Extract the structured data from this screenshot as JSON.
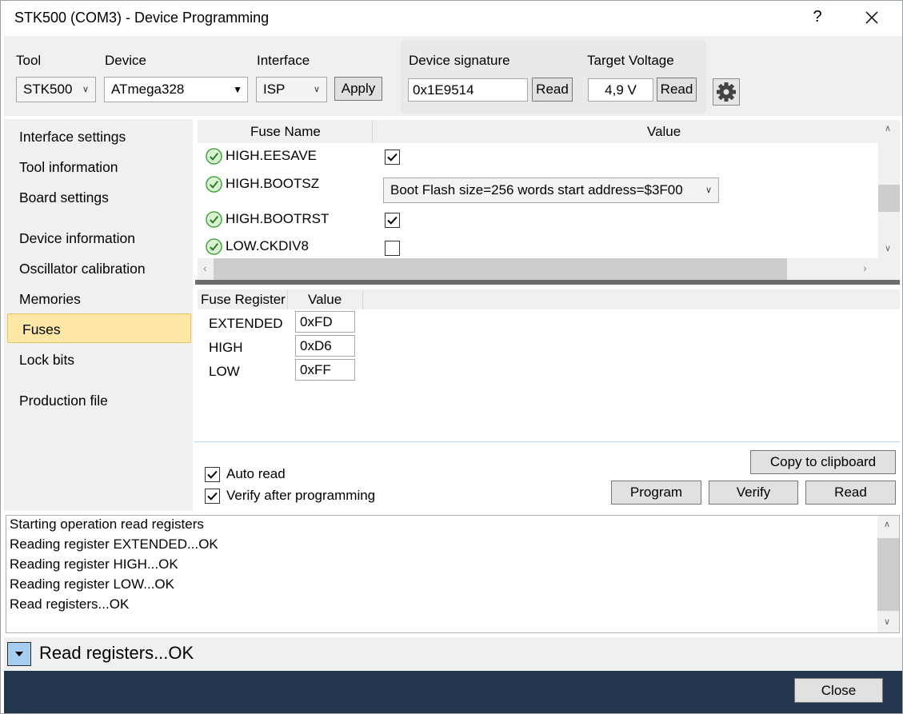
{
  "window": {
    "title": "STK500 (COM3) - Device Programming",
    "help": "?"
  },
  "toolbar": {
    "tool_label": "Tool",
    "tool_value": "STK500",
    "device_label": "Device",
    "device_value": "ATmega328",
    "interface_label": "Interface",
    "interface_value": "ISP",
    "apply": "Apply",
    "signature_label": "Device signature",
    "signature_value": "0x1E9514",
    "signature_read": "Read",
    "voltage_label": "Target Voltage",
    "voltage_value": "4,9 V",
    "voltage_read": "Read"
  },
  "nav": {
    "items": [
      {
        "label": "Interface settings"
      },
      {
        "label": "Tool information"
      },
      {
        "label": "Board settings"
      },
      {
        "label": "Device information"
      },
      {
        "label": "Oscillator calibration"
      },
      {
        "label": "Memories"
      },
      {
        "label": "Fuses"
      },
      {
        "label": "Lock bits"
      },
      {
        "label": "Production file"
      }
    ],
    "selected": "Fuses"
  },
  "fuses": {
    "col_name": "Fuse Name",
    "col_value": "Value",
    "rows": [
      {
        "name": "HIGH.EESAVE",
        "type": "checkbox",
        "checked": true
      },
      {
        "name": "HIGH.BOOTSZ",
        "type": "select",
        "value": "Boot Flash size=256 words start address=$3F00"
      },
      {
        "name": "HIGH.BOOTRST",
        "type": "checkbox",
        "checked": true
      },
      {
        "name": "LOW.CKDIV8",
        "type": "checkbox",
        "checked": false
      }
    ]
  },
  "registers": {
    "col_name": "Fuse Register",
    "col_value": "Value",
    "rows": [
      {
        "name": "EXTENDED",
        "value": "0xFD"
      },
      {
        "name": "HIGH",
        "value": "0xD6"
      },
      {
        "name": "LOW",
        "value": "0xFF"
      }
    ]
  },
  "options": {
    "auto_read": "Auto read",
    "verify": "Verify after programming"
  },
  "actions": {
    "copy": "Copy to clipboard",
    "program": "Program",
    "verify": "Verify",
    "read": "Read"
  },
  "log": {
    "lines": [
      "Starting operation read registers",
      "Reading register EXTENDED...OK",
      "Reading register HIGH...OK",
      "Reading register LOW...OK",
      "Read registers...OK"
    ]
  },
  "status": {
    "text": "Read registers...OK"
  },
  "footer": {
    "close": "Close"
  },
  "colors": {
    "selection": "#ffe8a6",
    "footer": "#243550",
    "ok_green": "#3aa335"
  }
}
